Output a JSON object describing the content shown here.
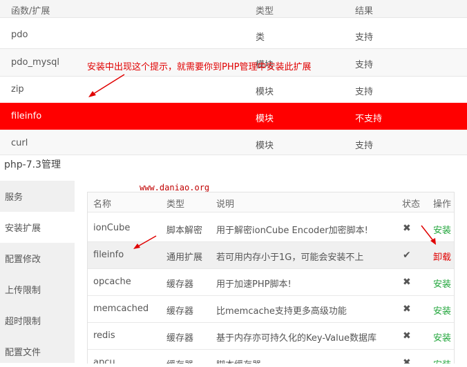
{
  "top_table": {
    "headers": [
      "函数/扩展",
      "类型",
      "结果"
    ],
    "rows": [
      {
        "name": "pdo",
        "type": "类",
        "result": "支持"
      },
      {
        "name": "pdo_mysql",
        "type": "模块",
        "result": "支持"
      },
      {
        "name": "zip",
        "type": "模块",
        "result": "支持"
      },
      {
        "name": "fileinfo",
        "type": "模块",
        "result": "不支持"
      },
      {
        "name": "curl",
        "type": "模块",
        "result": "支持"
      }
    ]
  },
  "annotation": "安装中出现这个提示，就需要你到PHP管理中安装此扩展",
  "php_manager": {
    "title": "php-7.3管理",
    "watermark": "www.daniao.org",
    "sidebar": [
      "服务",
      "安装扩展",
      "配置修改",
      "上传限制",
      "超时限制",
      "配置文件"
    ],
    "headers": [
      "名称",
      "类型",
      "说明",
      "状态",
      "操作"
    ],
    "rows": [
      {
        "name": "ionCube",
        "type": "脚本解密",
        "desc": "用于解密ionCube Encoder加密脚本!",
        "status": "✖",
        "action": "安装"
      },
      {
        "name": "fileinfo",
        "type": "通用扩展",
        "desc": "若可用内存小于1G，可能会安装不上",
        "status": "✔",
        "action": "卸载"
      },
      {
        "name": "opcache",
        "type": "缓存器",
        "desc": "用于加速PHP脚本!",
        "status": "✖",
        "action": "安装"
      },
      {
        "name": "memcached",
        "type": "缓存器",
        "desc": "比memcache支持更多高级功能",
        "status": "✖",
        "action": "安装"
      },
      {
        "name": "redis",
        "type": "缓存器",
        "desc": "基于内存亦可持久化的Key-Value数据库",
        "status": "✖",
        "action": "安装"
      },
      {
        "name": "apcu",
        "type": "缓存器",
        "desc": "脚本缓存器",
        "status": "✖",
        "action": "安装"
      }
    ]
  },
  "colors": {
    "highlight": "#ff0000",
    "install": "#20a53a",
    "uninstall": "#e00000"
  }
}
